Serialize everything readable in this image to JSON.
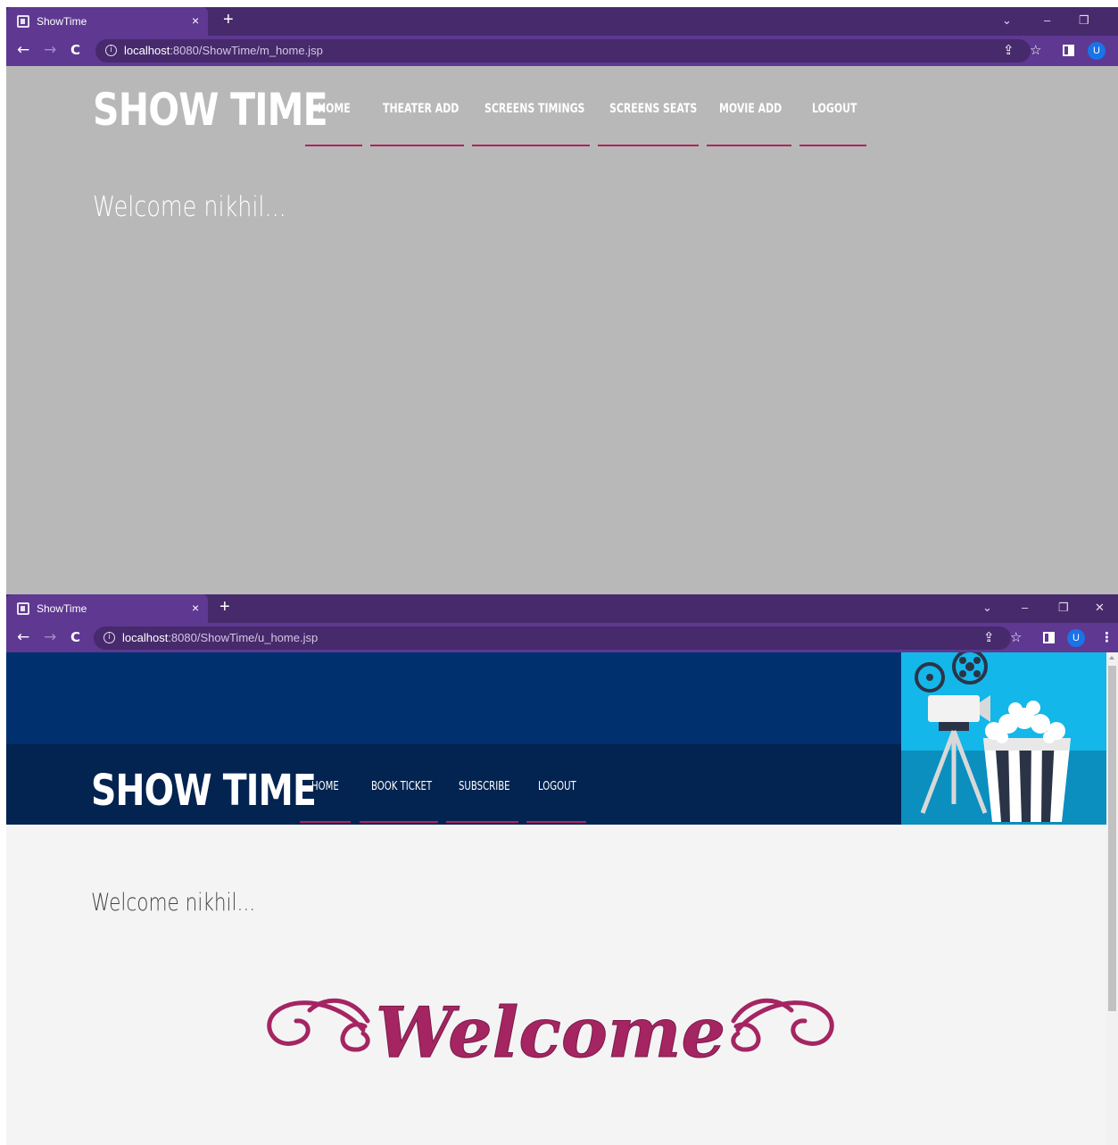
{
  "manager_window": {
    "tab_title": "ShowTime",
    "url_host": "localhost",
    "url_rest": ":8080/ShowTime/m_home.jsp",
    "brand": "SHOW TIME",
    "nav": [
      "HOME",
      "THEATER ADD",
      "SCREENS TIMINGS",
      "SCREENS SEATS",
      "MOVIE ADD",
      "LOGOUT"
    ],
    "welcome": "Welcome nikhil...",
    "avatar_letter": "U"
  },
  "user_window": {
    "tab_title": "ShowTime",
    "url_host": "localhost",
    "url_rest": ":8080/ShowTime/u_home.jsp",
    "brand": "SHOW TIME",
    "nav": [
      "HOME",
      "BOOK TICKET",
      "SUBSCRIBE",
      "LOGOUT"
    ],
    "welcome": "Welcome nikhil...",
    "script_welcome": "Welcome",
    "avatar_letter": "U"
  },
  "icons": {
    "tab_close": "×",
    "new_tab": "+",
    "back": "←",
    "forward": "→",
    "reload": "C",
    "info": "i",
    "share": "⇪",
    "star": "☆",
    "tab_search": "⌄",
    "minimize": "–",
    "restore": "❐",
    "close": "✕",
    "menu": "⋮"
  },
  "colors": {
    "chrome_frame": "#472a6b",
    "chrome_toolbar": "#5e3891",
    "accent_underline": "#b0245e",
    "manager_bg": "#b8b8b8",
    "user_header": "#00306e",
    "user_nav": "#032350",
    "script_text": "#a42562"
  }
}
